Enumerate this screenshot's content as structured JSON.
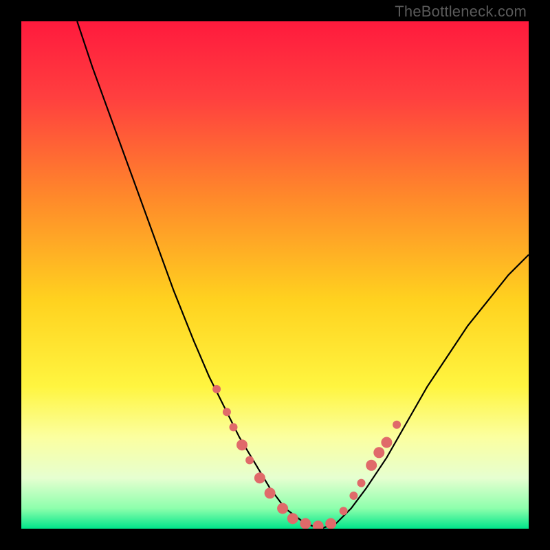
{
  "watermark": "TheBottleneck.com",
  "chart_data": {
    "type": "line",
    "title": "",
    "xlabel": "",
    "ylabel": "",
    "xlim": [
      0,
      100
    ],
    "ylim": [
      0,
      100
    ],
    "background_gradient": {
      "stops": [
        {
          "offset": 0.0,
          "color": "#ff1a3d"
        },
        {
          "offset": 0.15,
          "color": "#ff3f3f"
        },
        {
          "offset": 0.35,
          "color": "#ff8a2a"
        },
        {
          "offset": 0.55,
          "color": "#ffd21f"
        },
        {
          "offset": 0.72,
          "color": "#fff540"
        },
        {
          "offset": 0.82,
          "color": "#fbffa0"
        },
        {
          "offset": 0.9,
          "color": "#e6ffd0"
        },
        {
          "offset": 0.96,
          "color": "#8dffac"
        },
        {
          "offset": 1.0,
          "color": "#00e58a"
        }
      ]
    },
    "curve": {
      "x": [
        11,
        14,
        18,
        22,
        26,
        30,
        34,
        37,
        40,
        43,
        46,
        49,
        52,
        56,
        59,
        62,
        65,
        68,
        72,
        76,
        80,
        84,
        88,
        92,
        96,
        100
      ],
      "y": [
        100,
        91,
        80,
        69,
        58,
        47,
        37,
        30,
        24,
        18,
        13,
        8,
        4,
        1,
        0,
        1,
        4,
        8,
        14,
        21,
        28,
        34,
        40,
        45,
        50,
        54
      ]
    },
    "series": [
      {
        "name": "dots",
        "color": "#e06a6a",
        "radius_small": 6,
        "radius_large": 8,
        "points": [
          {
            "x": 38.5,
            "y": 27.5,
            "r": "small"
          },
          {
            "x": 40.5,
            "y": 23.0,
            "r": "small"
          },
          {
            "x": 41.8,
            "y": 20.0,
            "r": "small"
          },
          {
            "x": 43.5,
            "y": 16.5,
            "r": "large"
          },
          {
            "x": 45.0,
            "y": 13.5,
            "r": "small"
          },
          {
            "x": 47.0,
            "y": 10.0,
            "r": "large"
          },
          {
            "x": 49.0,
            "y": 7.0,
            "r": "large"
          },
          {
            "x": 51.5,
            "y": 4.0,
            "r": "large"
          },
          {
            "x": 53.5,
            "y": 2.0,
            "r": "large"
          },
          {
            "x": 56.0,
            "y": 1.0,
            "r": "large"
          },
          {
            "x": 58.5,
            "y": 0.5,
            "r": "large"
          },
          {
            "x": 61.0,
            "y": 1.0,
            "r": "large"
          },
          {
            "x": 63.5,
            "y": 3.5,
            "r": "small"
          },
          {
            "x": 65.5,
            "y": 6.5,
            "r": "small"
          },
          {
            "x": 67.0,
            "y": 9.0,
            "r": "small"
          },
          {
            "x": 69.0,
            "y": 12.5,
            "r": "large"
          },
          {
            "x": 70.5,
            "y": 15.0,
            "r": "large"
          },
          {
            "x": 72.0,
            "y": 17.0,
            "r": "large"
          },
          {
            "x": 74.0,
            "y": 20.5,
            "r": "small"
          }
        ]
      }
    ]
  }
}
